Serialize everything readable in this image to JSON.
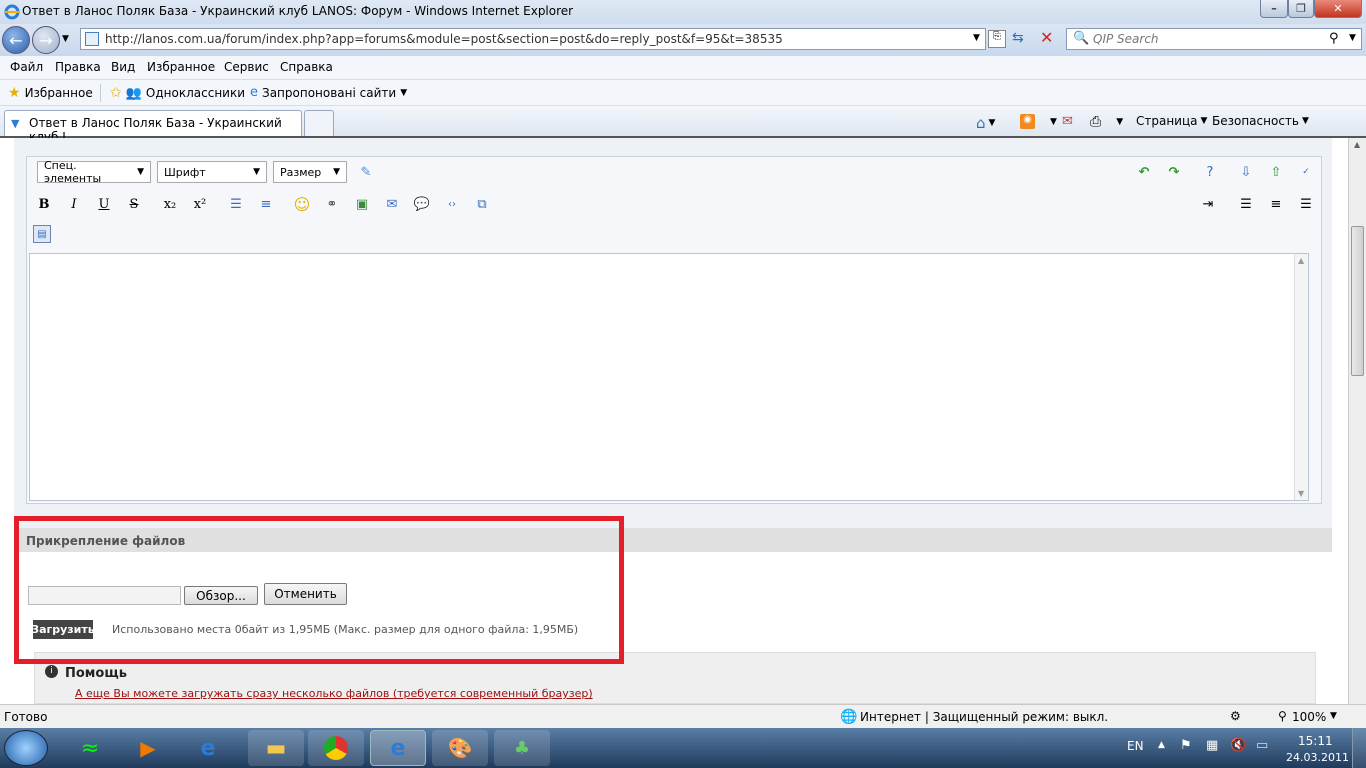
{
  "window": {
    "title": "Ответ в Ланос Поляк База - Украинский клуб LANOS: Форум - Windows Internet Explorer"
  },
  "address": {
    "url": "http://lanos.com.ua/forum/index.php?app=forums&module=post&section=post&do=reply_post&f=95&t=38535"
  },
  "search": {
    "placeholder": "QIP Search"
  },
  "menu": [
    "Файл",
    "Правка",
    "Вид",
    "Избранное",
    "Сервис",
    "Справка"
  ],
  "favorites": {
    "label": "Избранное",
    "items": [
      "Одноклассники",
      "Запропоновані сайти"
    ]
  },
  "tab": {
    "label": "Ответ в Ланос Поляк База - Украинский клуб L..."
  },
  "tools": {
    "page": "Страница",
    "security": "Безопасность"
  },
  "editor": {
    "special": "Спец. элементы",
    "font": "Шрифт",
    "size": "Размер",
    "buttons": [
      "B",
      "I",
      "U",
      "S"
    ]
  },
  "attachments": {
    "heading": "Прикрепление файлов",
    "browse": "Обзор...",
    "cancel": "Отменить",
    "upload": "Загрузить",
    "usage": "Использовано места 0байт из 1,95МБ (Макс. размер для одного файла: 1,95МБ)"
  },
  "help": {
    "title": "Помощь",
    "link": "А еще Вы можете загружать сразу несколько файлов (требуется современный браузер)"
  },
  "status": {
    "left": "Готово",
    "zone": "Интернет | Защищенный режим: выкл.",
    "zoom": "100%"
  },
  "taskbar": {
    "lang": "EN",
    "time": "15:11",
    "date": "24.03.2011"
  }
}
